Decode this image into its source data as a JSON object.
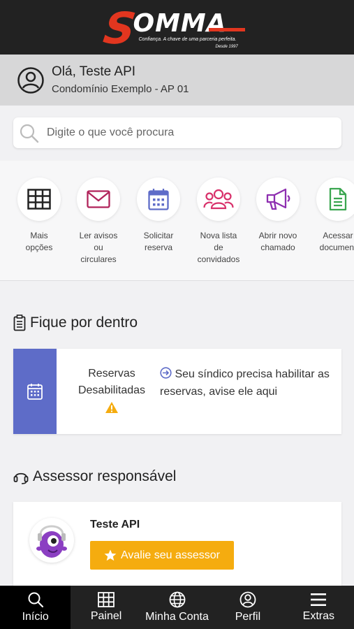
{
  "header": {
    "logo_text": "OMMA",
    "logo_letter": "S",
    "tagline": "Confiança. A chave de uma parceria perfeita.",
    "since": "Desde 1997"
  },
  "user": {
    "greeting": "Olá, Teste API",
    "unit": "Condomínio Exemplo - AP 01"
  },
  "search": {
    "placeholder": "Digite o que você procura"
  },
  "shortcuts": [
    {
      "label": "Mais\nopções",
      "icon": "grid-icon",
      "color": "#222222"
    },
    {
      "label": "Ler avisos\nou\ncirculares",
      "icon": "envelope-icon",
      "color": "#b0235a"
    },
    {
      "label": "Solicitar\nreserva",
      "icon": "calendar-icon",
      "color": "#5e6cc8"
    },
    {
      "label": "Nova lista\nde\nconvidados",
      "icon": "group-icon",
      "color": "#d8306a"
    },
    {
      "label": "Abrir novo\nchamado",
      "icon": "megaphone-icon",
      "color": "#8e2fb0"
    },
    {
      "label": "Acessar\ndocument",
      "icon": "document-icon",
      "color": "#3aa650"
    }
  ],
  "news_section": {
    "title": "Fique por dentro"
  },
  "reservation": {
    "status": "Reservas Desabilitadas",
    "message": "Seu síndico precisa habilitar as reservas, avise ele aqui",
    "stripe_color": "#5e6cc8",
    "warning_color": "#f5ac0f"
  },
  "advisor_section": {
    "title": "Assessor responsável"
  },
  "advisor": {
    "name": "Teste API",
    "rate_label": "Avalie seu assessor",
    "button_color": "#f5ac0f"
  },
  "nav": [
    {
      "label": "Início",
      "icon": "search-icon",
      "active": true
    },
    {
      "label": "Painel",
      "icon": "grid-icon",
      "active": false
    },
    {
      "label": "Minha Conta",
      "icon": "globe-icon",
      "active": false
    },
    {
      "label": "Perfil",
      "icon": "user-icon",
      "active": false
    },
    {
      "label": "Extras",
      "icon": "menu-icon",
      "active": false
    }
  ]
}
